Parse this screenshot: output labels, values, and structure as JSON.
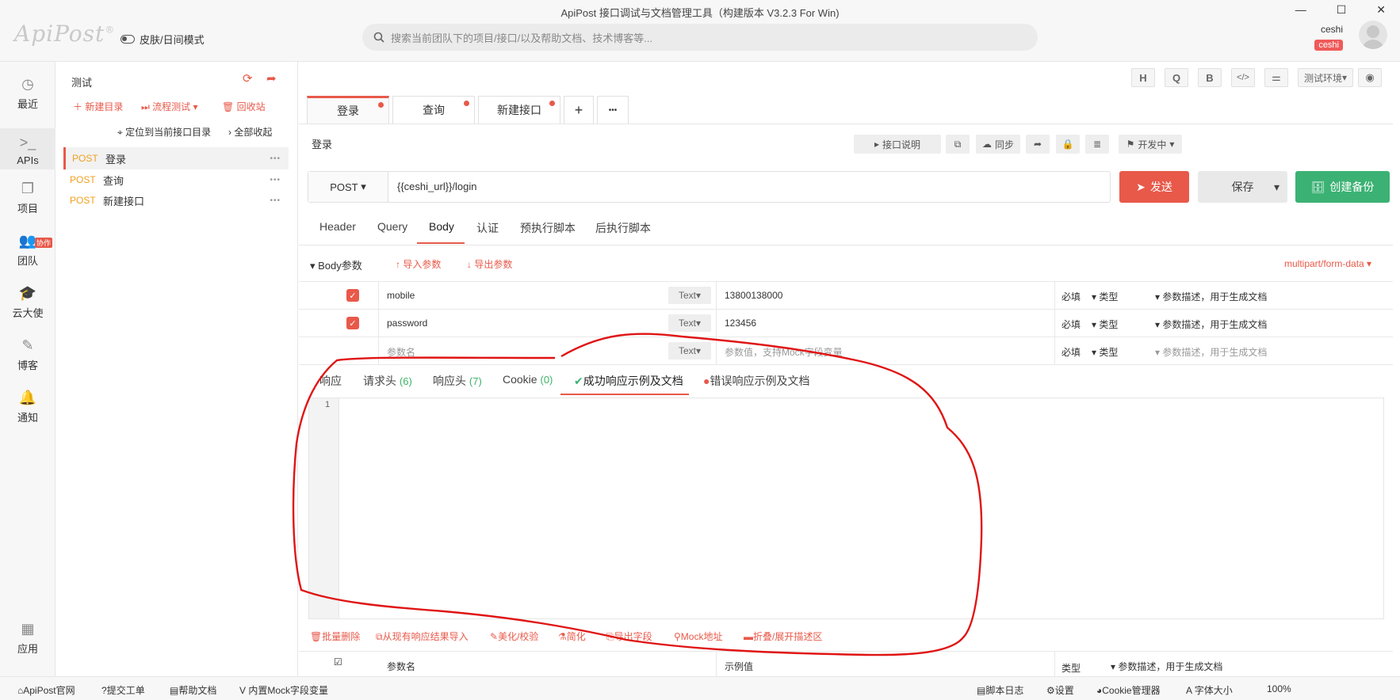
{
  "window": {
    "title": "ApiPost 接口调试与文档管理工具（构建版本 V3.2.3 For Win)"
  },
  "header": {
    "logo": "ApiPost",
    "logo_mark": "®",
    "skin_label": "皮肤/日间模式",
    "search_placeholder": "搜索当前团队下的项目/接口/以及帮助文档、技术博客等...",
    "user_name": "ceshi",
    "user_badge": "ceshi"
  },
  "nav": {
    "items": [
      {
        "label": "最近",
        "icon": "clock-icon"
      },
      {
        "label": "APIs",
        "icon": "terminal-icon"
      },
      {
        "label": "项目",
        "icon": "project-icon"
      },
      {
        "label": "团队",
        "icon": "team-icon",
        "badge": "协作"
      },
      {
        "label": "云大使",
        "icon": "graduation-cap-icon"
      },
      {
        "label": "博客",
        "icon": "edit-icon"
      },
      {
        "label": "通知",
        "icon": "bell-icon"
      },
      {
        "label": "应用",
        "icon": "grid-icon"
      }
    ]
  },
  "tree": {
    "project": "测试",
    "new_dir": "新建目录",
    "flow_test": "流程测试",
    "recycle": "回收站",
    "locate": "定位到当前接口目录",
    "collapse": "全部收起",
    "items": [
      {
        "method": "POST",
        "name": "登录"
      },
      {
        "method": "POST",
        "name": "查询"
      },
      {
        "method": "POST",
        "name": "新建接口"
      }
    ]
  },
  "toolbar": {
    "buttons": [
      "H",
      "Q",
      "B",
      "</>",
      "⚌"
    ],
    "env": "测试环境",
    "eye": "◉"
  },
  "tabs": [
    {
      "label": "登录"
    },
    {
      "label": "查询"
    },
    {
      "label": "新建接口"
    }
  ],
  "request": {
    "name": "登录",
    "doc_btn": "接口说明",
    "sync_btn": "同步",
    "status": "开发中",
    "method": "POST",
    "url": "{{ceshi_url}}/login",
    "send": "发送",
    "save": "保存",
    "backup": "创建备份"
  },
  "subtabs": [
    "Header",
    "Query",
    "Body",
    "认证",
    "预执行脚本",
    "后执行脚本"
  ],
  "body": {
    "title": "Body参数",
    "import": "导入参数",
    "export": "导出参数",
    "content_type": "multipart/form-data",
    "rows": [
      {
        "key": "mobile",
        "type": "Text",
        "value": "13800138000",
        "required": "必填",
        "kind": "类型",
        "desc": "参数描述，用于生成文档"
      },
      {
        "key": "password",
        "type": "Text",
        "value": "123456",
        "required": "必填",
        "kind": "类型",
        "desc": "参数描述，用于生成文档"
      },
      {
        "key": "参数名",
        "type": "Text",
        "value": "参数值，支持Mock字段变量",
        "required": "必填",
        "kind": "类型",
        "desc": "参数描述，用于生成文档"
      }
    ]
  },
  "response": {
    "tabs": [
      "响应",
      "请求头",
      "响应头",
      "Cookie",
      "成功响应示例及文档",
      "错误响应示例及文档"
    ],
    "counts": {
      "req_headers": "(6)",
      "resp_headers": "(7)",
      "cookie": "(0)"
    },
    "line_no": "1",
    "tools": [
      "批量删除",
      "从现有响应结果导入",
      "美化/校验",
      "简化",
      "导出字段",
      "Mock地址",
      "折叠/展开描述区"
    ],
    "field_header": {
      "name": "参数名",
      "example": "示例值",
      "kind": "类型",
      "desc": "参数描述，用于生成文档"
    }
  },
  "status": {
    "left": [
      "ApiPost官网",
      "提交工单",
      "帮助文档",
      "内置Mock字段变量"
    ],
    "right": [
      "脚本日志",
      "设置",
      "Cookie管理器",
      "字体大小",
      "100%"
    ]
  }
}
